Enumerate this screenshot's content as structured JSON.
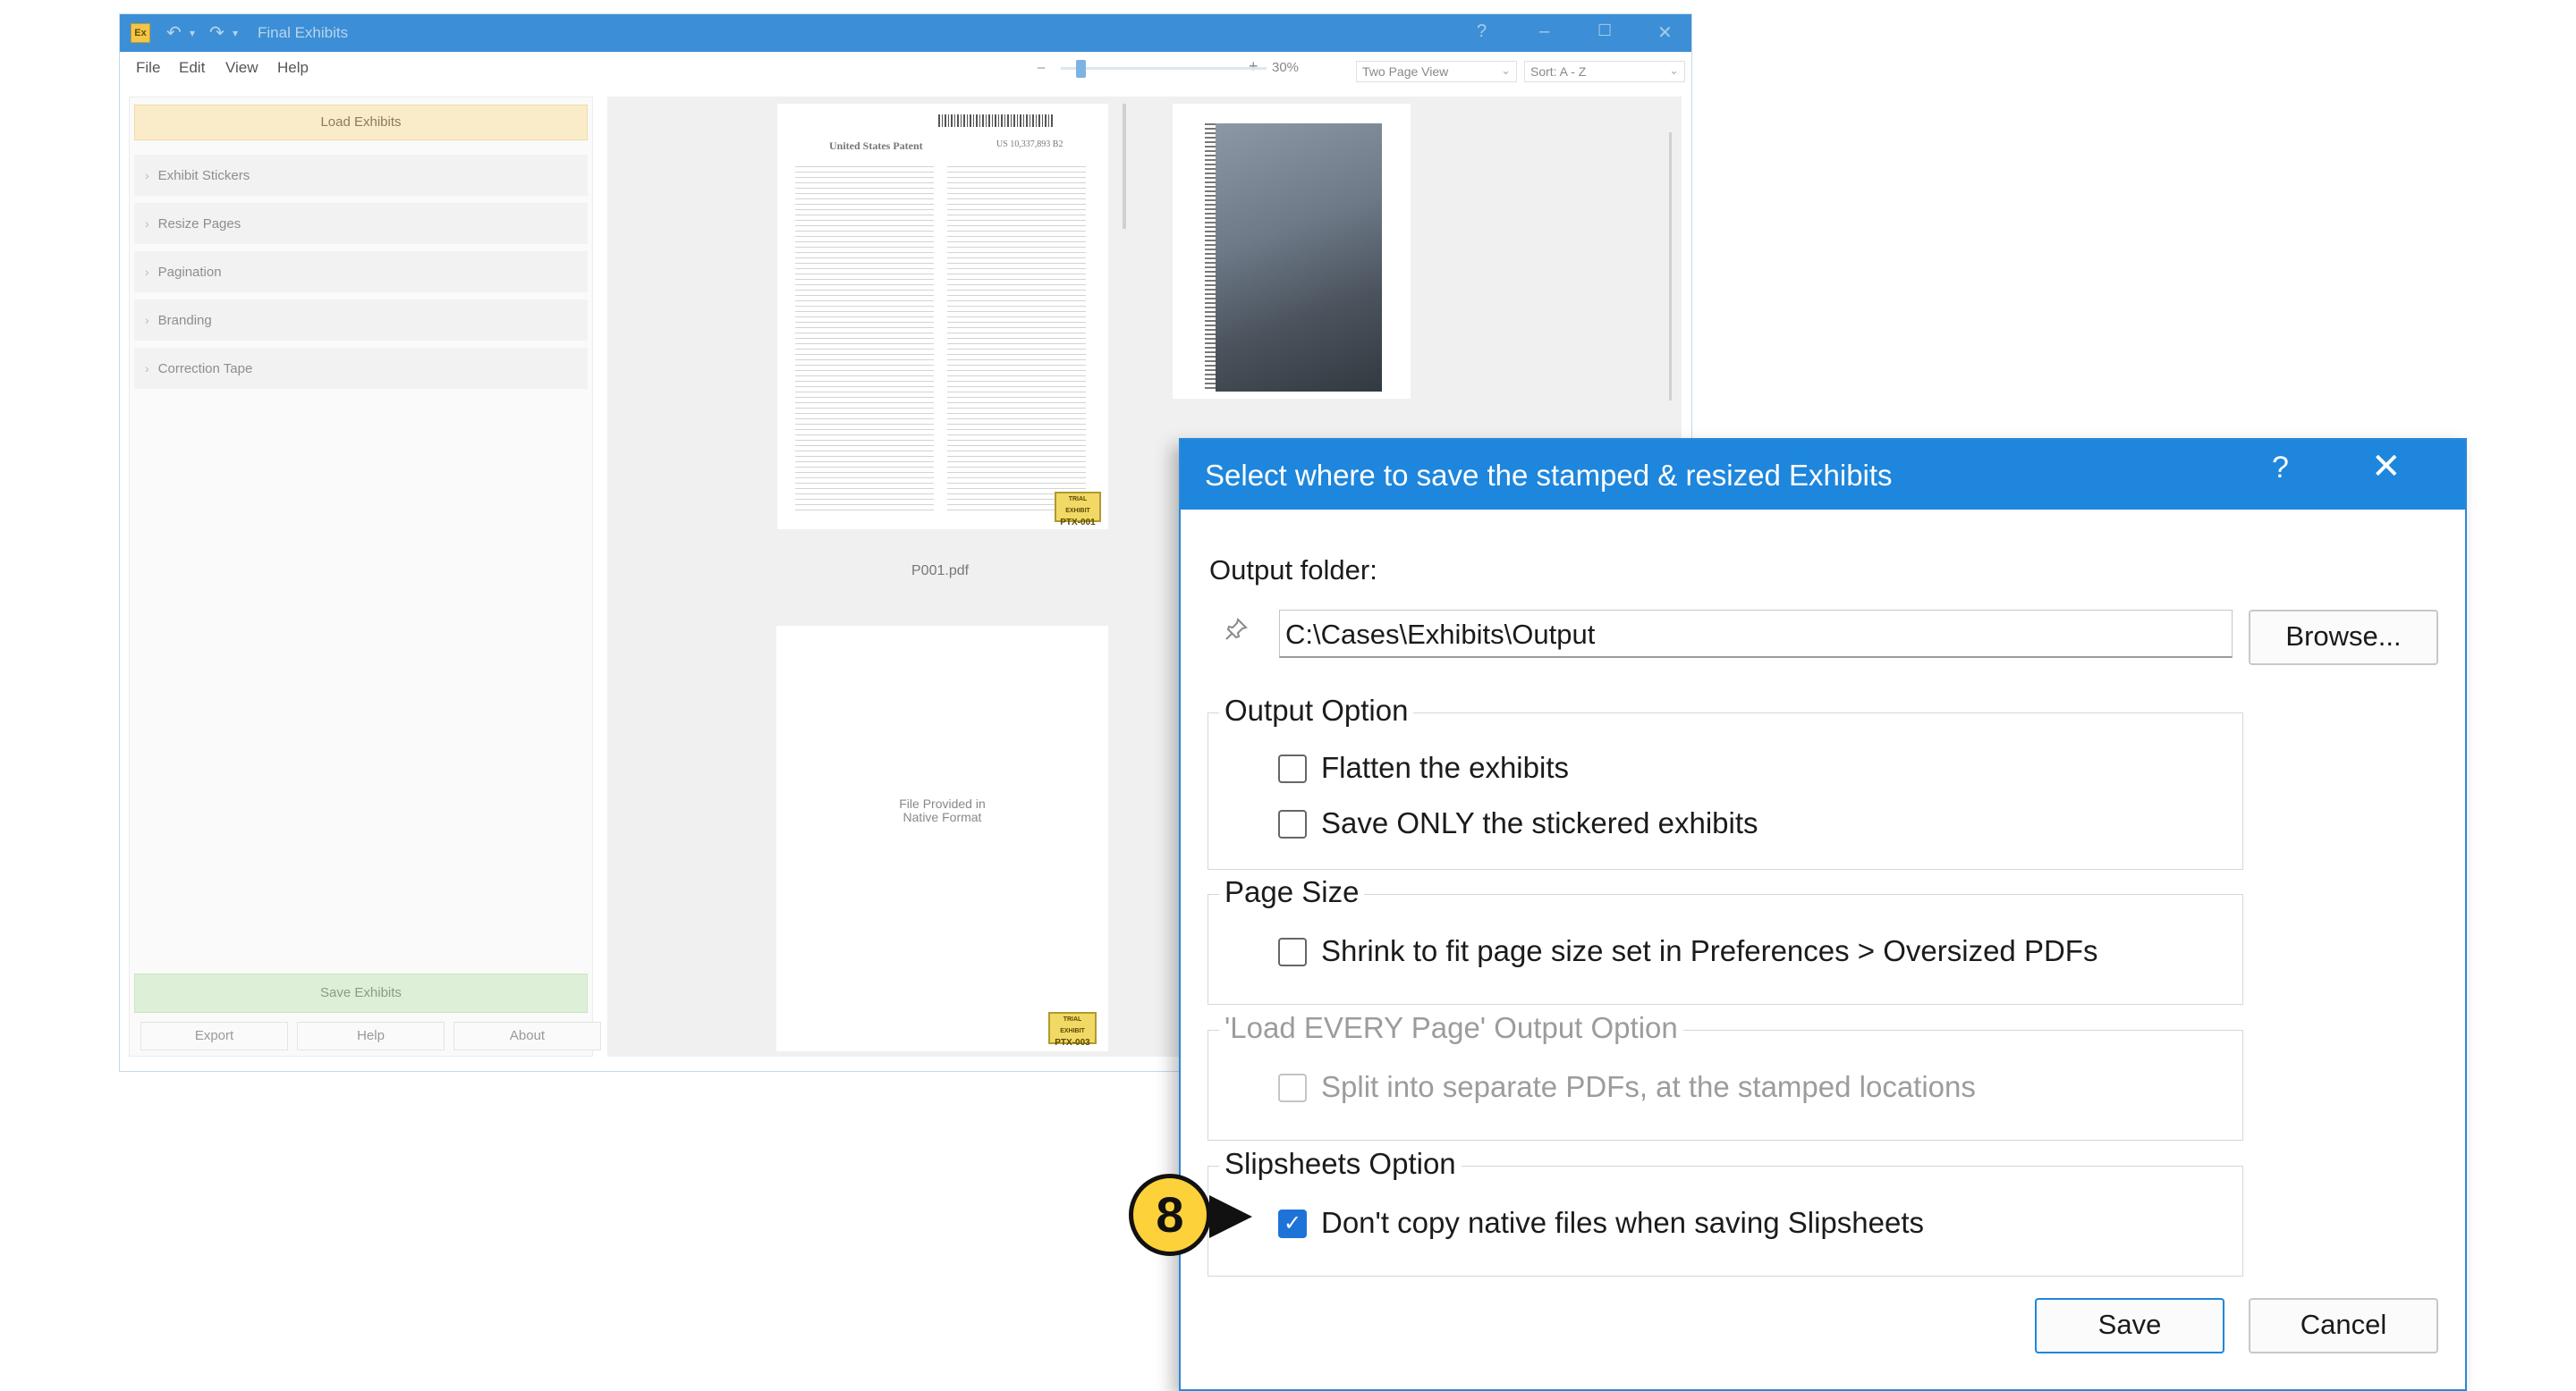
{
  "app": {
    "icon_text": "Ex",
    "title": "Final Exhibits",
    "window_help": "?",
    "menu": [
      "File",
      "Edit",
      "View",
      "Help"
    ],
    "zoom_minus": "–",
    "zoom_plus": "+",
    "zoom_level": "30%",
    "view_mode": "Two Page View",
    "sort": "Sort: A - Z",
    "load_button": "Load Exhibits",
    "sidebar_items": [
      "Exhibit Stickers",
      "Resize Pages",
      "Pagination",
      "Branding",
      "Correction Tape"
    ],
    "save_button": "Save Exhibits",
    "footer_buttons": [
      "Export",
      "Help",
      "About"
    ],
    "pages": [
      {
        "caption": "P001.pdf",
        "sticker_top": "TRIAL EXHIBIT",
        "sticker_id": "PTX-001",
        "doc_title": "United States Patent",
        "patent_no": "US 10,337,893 B2"
      },
      {
        "native_line1": "File Provided in",
        "native_line2": "Native Format",
        "sticker_top": "TRIAL EXHIBIT",
        "sticker_id": "PTX-003"
      }
    ]
  },
  "dialog": {
    "title": "Select where to save the stamped & resized Exhibits",
    "help": "?",
    "close": "✕",
    "output_folder_label": "Output folder:",
    "output_folder_path": "C:\\Cases\\Exhibits\\Output",
    "browse_button": "Browse...",
    "groups": {
      "output_option": {
        "legend": "Output Option",
        "options": [
          {
            "label": "Flatten the exhibits",
            "checked": false
          },
          {
            "label": "Save ONLY the stickered exhibits",
            "checked": false
          }
        ]
      },
      "page_size": {
        "legend": "Page Size",
        "options": [
          {
            "label": "Shrink to fit page size set in Preferences > Oversized PDFs",
            "checked": false
          }
        ]
      },
      "load_every_page": {
        "legend": "'Load EVERY Page' Output Option",
        "disabled": true,
        "options": [
          {
            "label": "Split into separate PDFs, at the stamped locations",
            "checked": false
          }
        ]
      },
      "slipsheets": {
        "legend": "Slipsheets Option",
        "options": [
          {
            "label": "Don't copy native files when saving Slipsheets",
            "checked": true
          }
        ]
      }
    },
    "save_button": "Save",
    "cancel_button": "Cancel"
  },
  "callout": {
    "number": "8"
  },
  "colors": {
    "accent": "#1e86dc",
    "callout": "#fcd13a",
    "load": "#fbecc9",
    "save": "#ddf0d7"
  }
}
